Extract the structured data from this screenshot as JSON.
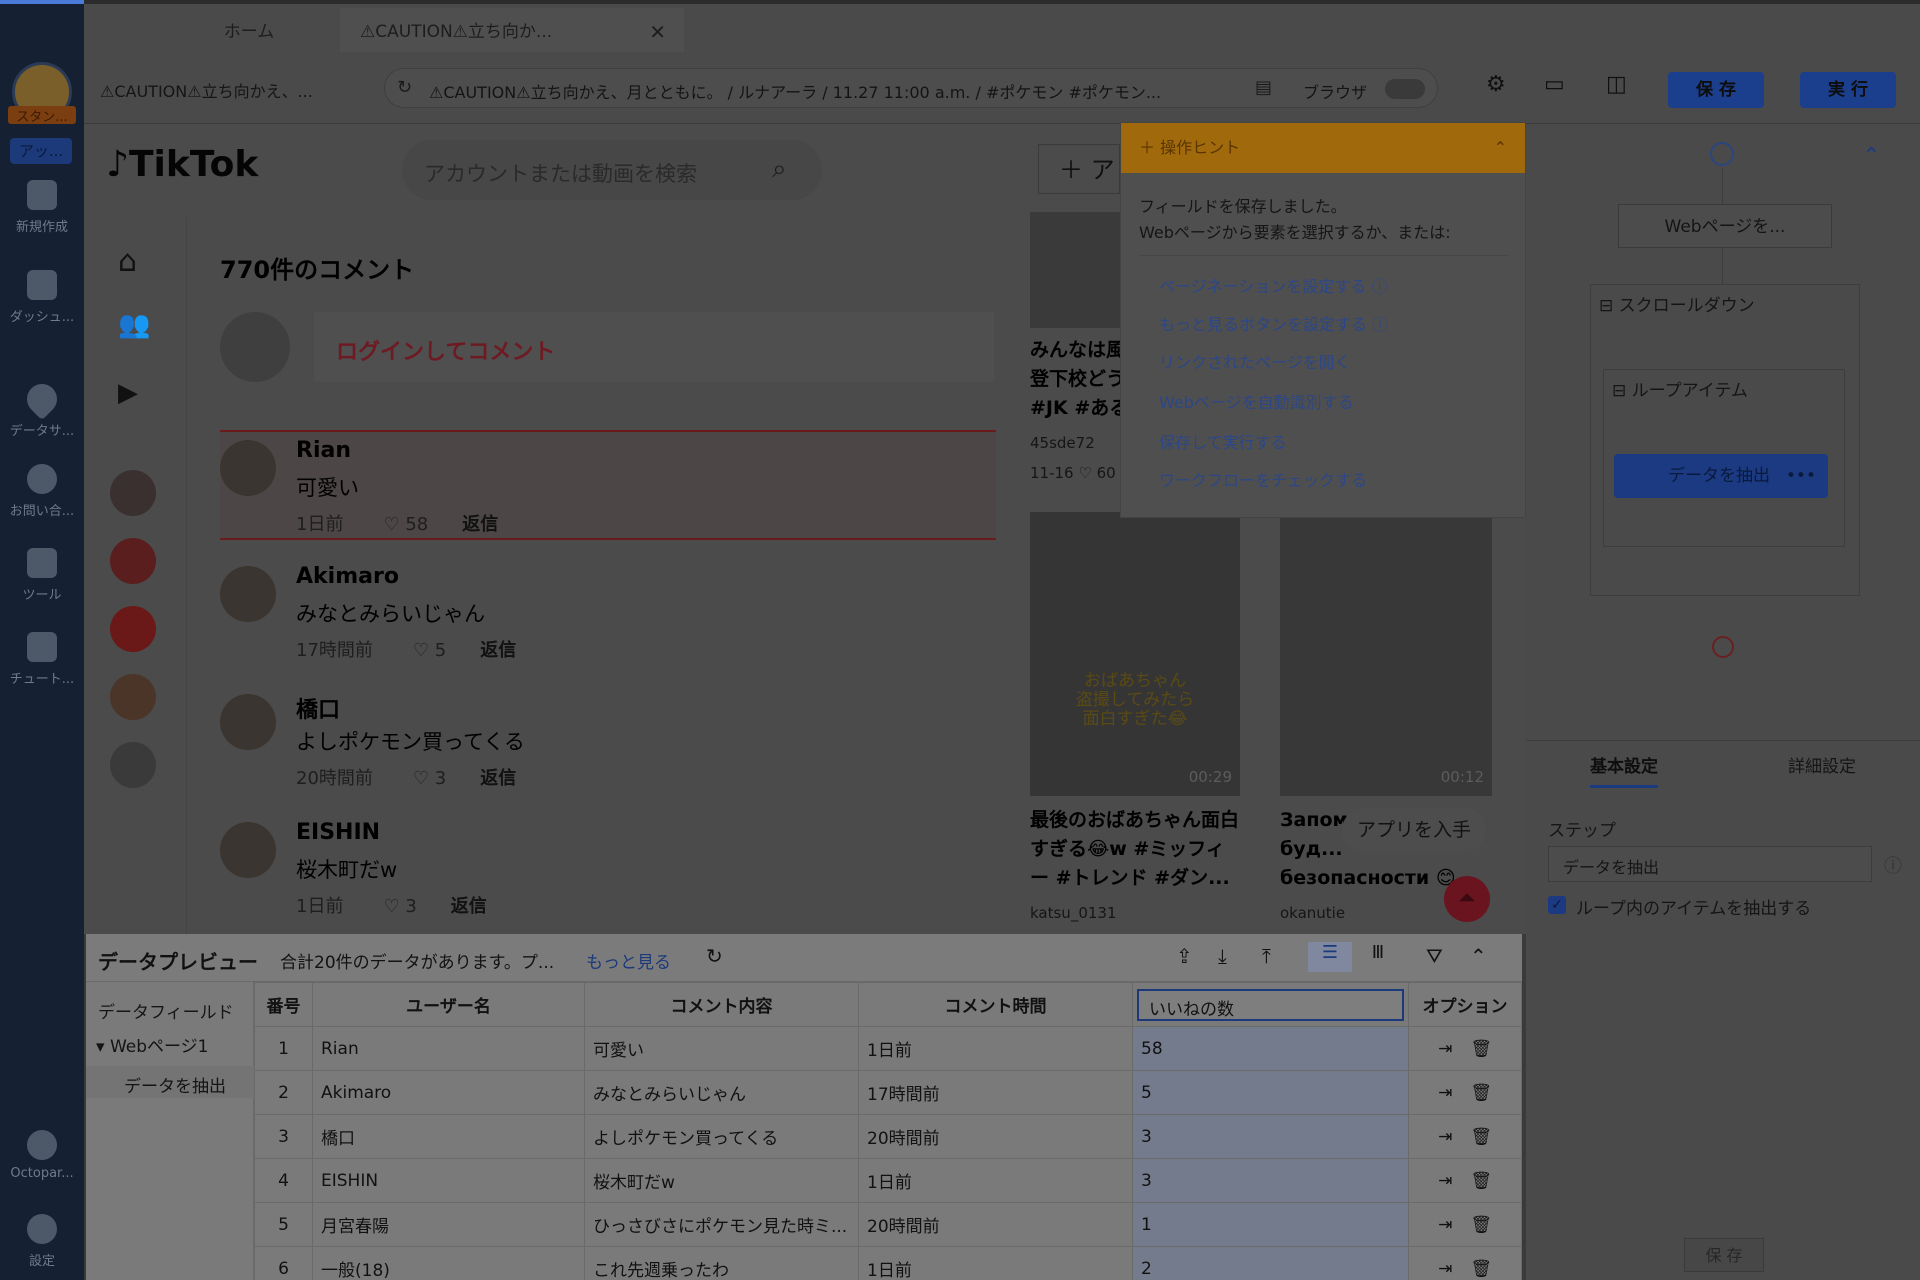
{
  "rail": {
    "user_badge": "スタン...",
    "app_badge": "アッ...",
    "items": [
      {
        "label": "新規作成",
        "icon": "plus-icon"
      },
      {
        "label": "ダッシュ...",
        "icon": "dashboard-icon"
      },
      {
        "label": "データサ...",
        "icon": "data-service-icon"
      },
      {
        "label": "お問い合...",
        "icon": "headset-icon"
      },
      {
        "label": "ツール",
        "icon": "toolbox-icon"
      },
      {
        "label": "チュート...",
        "icon": "graduation-icon"
      }
    ],
    "bottom": [
      {
        "label": "Octopar...",
        "icon": "info-icon"
      },
      {
        "label": "設定",
        "icon": "gear-icon"
      }
    ]
  },
  "tabs": [
    {
      "label": "ホーム"
    },
    {
      "label": "⚠CAUTION⚠立ち向か..."
    }
  ],
  "toolbar": {
    "page_title": "⚠CAUTION⚠立ち向かえ、...",
    "url": "⚠CAUTION⚠立ち向かえ、月とともに。 / ルナアーラ / 11.27 11:00 a.m. / #ポケモン #ポケモン...",
    "browser_label": "ブラウザ",
    "save_label": "保 存",
    "run_label": "実 行"
  },
  "tiktok": {
    "logo": "TikTok",
    "search_placeholder": "アカウントまたは動画を検索",
    "upload_label": "ア",
    "comments_title": "770件のコメント",
    "login_prompt": "ログインしてコメント",
    "comments": [
      {
        "user": "Rian",
        "text": "可愛い",
        "time": "1日前",
        "likes": "58",
        "reply": "返信"
      },
      {
        "user": "Akimaro",
        "text": "みなとみらいじゃん",
        "time": "17時間前",
        "likes": "5",
        "reply": "返信"
      },
      {
        "user": "橋口",
        "text": "よしポケモン買ってくる",
        "time": "20時間前",
        "likes": "3",
        "reply": "返信"
      },
      {
        "user": "EISHIN",
        "text": "桜木町だw",
        "time": "1日前",
        "likes": "3",
        "reply": "返信"
      }
    ],
    "videos": [
      {
        "title1": "みんなは風",
        "title2": "登下校どう",
        "title3": "#JK #ある",
        "author": "45sde72",
        "date": "11-16",
        "likes": "60"
      },
      {
        "overlay": "おばあちゃん\n盗撮してみたら\n面白すぎた😂",
        "duration": "00:29",
        "title": "最後のおばあちゃん面白すぎる😂w #ミッフィー #トレンド #ダン...",
        "author": "katsu_0131"
      },
      {
        "duration": "00:12",
        "title": "Запом... 🙏 и буд... безопасности 😊",
        "author": "okanutie"
      }
    ],
    "get_app": "アプリを入手"
  },
  "hint": {
    "title": "操作ヒント",
    "line1": "フィールドを保存しました。",
    "line2": "Webページから要素を選択するか、または:",
    "links": [
      "ページネーションを設定する",
      "もっと見るボタンを設定する",
      "リンクされたページを開く",
      "Webページを自動識別する",
      "保存して実行する",
      "ワークフローをチェックする"
    ]
  },
  "workflow": {
    "open_page": "Webページを...",
    "scroll": "スクロールダウン",
    "loop": "ループアイテム",
    "extract": "データを抽出",
    "more": "•••"
  },
  "settings": {
    "tab_basic": "基本設定",
    "tab_advanced": "詳細設定",
    "step_label": "ステップ",
    "step_value": "データを抽出",
    "loop_checkbox": "ループ内のアイテムを抽出する",
    "save": "保 存"
  },
  "preview": {
    "title": "データプレビュー",
    "summary": "合計20件のデータがあります。プ...",
    "more": "もっと見る",
    "fields_label": "データフィールド",
    "page_node": "Webページ1",
    "extract_node": "データを抽出",
    "columns": [
      "番号",
      "ユーザー名",
      "コメント内容",
      "コメント時間",
      "いいねの数",
      "オプション"
    ],
    "rows": [
      [
        "1",
        "Rian",
        "可愛い",
        "1日前",
        "58"
      ],
      [
        "2",
        "Akimaro",
        "みなとみらいじゃん",
        "17時間前",
        "5"
      ],
      [
        "3",
        "橋口",
        "よしポケモン買ってくる",
        "20時間前",
        "3"
      ],
      [
        "4",
        "EISHIN",
        "桜木町だw",
        "1日前",
        "3"
      ],
      [
        "5",
        "月宮春陽",
        "ひっさびさにポケモン見た時ミ...",
        "20時間前",
        "1"
      ],
      [
        "6",
        "一般(18)",
        "これ先週乗ったわ",
        "1日前",
        "2"
      ]
    ]
  }
}
